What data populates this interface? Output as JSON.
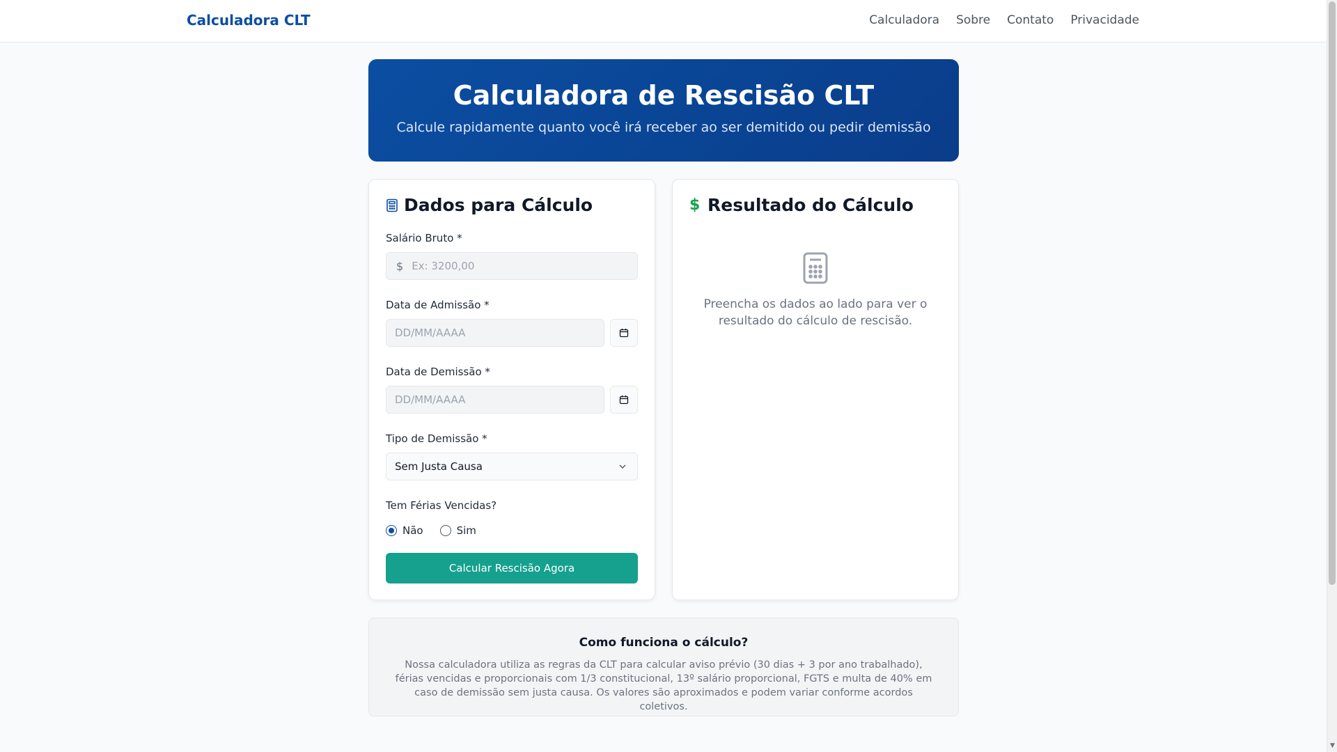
{
  "navbar": {
    "brand": "Calculadora CLT",
    "links": [
      "Calculadora",
      "Sobre",
      "Contato",
      "Privacidade"
    ]
  },
  "hero": {
    "title": "Calculadora de Rescisão CLT",
    "subtitle": "Calcule rapidamente quanto você irá receber ao ser demitido ou pedir demissão"
  },
  "form": {
    "heading": "Dados para Cálculo",
    "heading_icon": "calculator-icon",
    "salary": {
      "label": "Salário Bruto *",
      "prefix_icon": "dollar-icon",
      "placeholder": "Ex: 3200,00",
      "value": ""
    },
    "admission": {
      "label": "Data de Admissão *",
      "placeholder": "DD/MM/AAAA",
      "value": "",
      "button_icon": "calendar-icon"
    },
    "dismissal": {
      "label": "Data de Demissão *",
      "placeholder": "DD/MM/AAAA",
      "value": "",
      "button_icon": "calendar-icon"
    },
    "dismissal_type": {
      "label": "Tipo de Demissão *",
      "selected": "Sem Justa Causa"
    },
    "vacation": {
      "label": "Tem Férias Vencidas?",
      "options": [
        "Não",
        "Sim"
      ],
      "selected": "Não"
    },
    "submit_label": "Calcular Rescisão Agora"
  },
  "result": {
    "heading": "Resultado do Cálculo",
    "heading_icon": "dollar-icon",
    "empty_icon": "calculator-icon",
    "empty_text": "Preencha os dados ao lado para ver o resultado do cálculo de rescisão."
  },
  "info": {
    "title": "Como funciona o cálculo?",
    "text": "Nossa calculadora utiliza as regras da CLT para calcular aviso prévio (30 dias + 3 por ano trabalhado), férias vencidas e proporcionais com 1/3 constitucional, 13º salário proporcional, FGTS e multa de 40% em caso de demissão sem justa causa. Os valores são aproximados e podem variar conforme acordos coletivos."
  },
  "colors": {
    "brand": "#0b4ea2",
    "accent_button": "#16a08e",
    "success_icon": "#16a34a"
  }
}
